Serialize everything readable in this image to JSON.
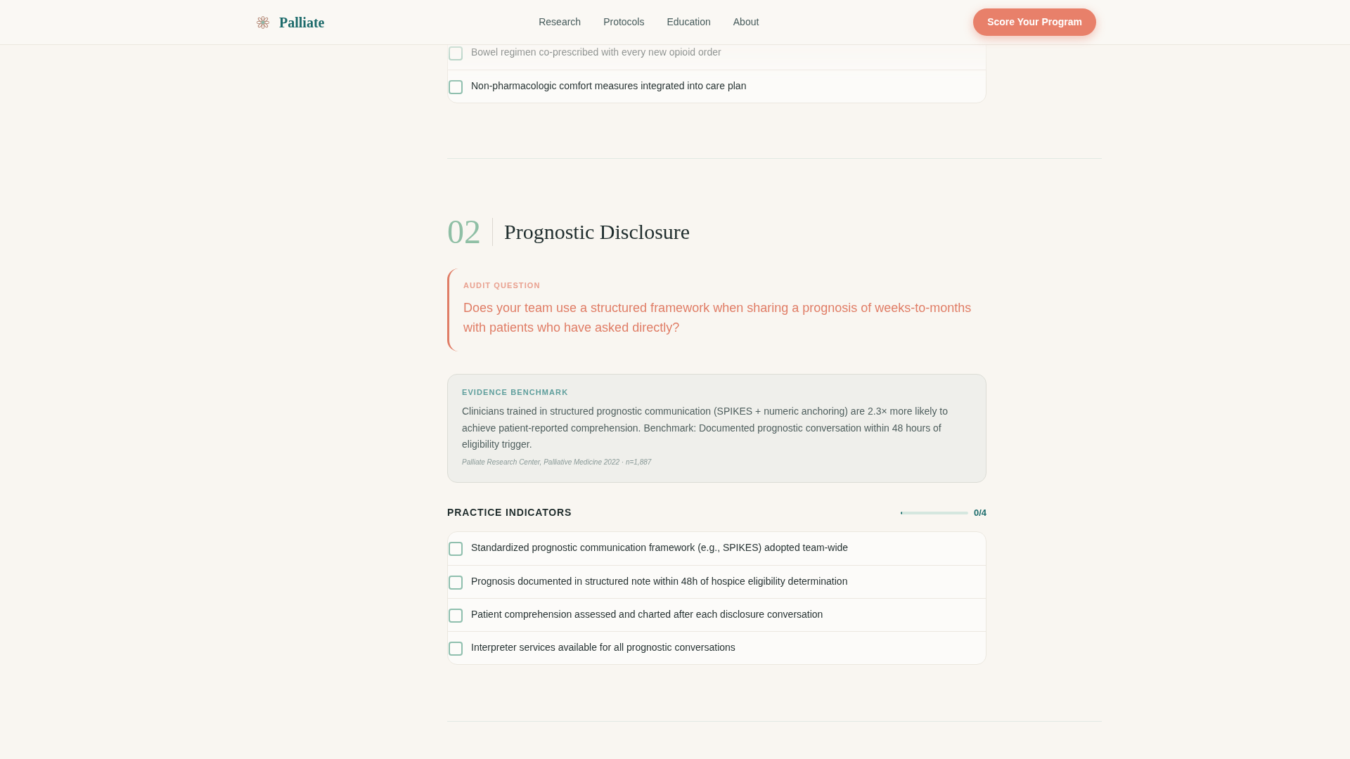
{
  "header": {
    "brand": "Palliate",
    "nav": [
      {
        "label": "Research"
      },
      {
        "label": "Protocols"
      },
      {
        "label": "Education"
      },
      {
        "label": "About"
      }
    ],
    "cta": "Score Your Program"
  },
  "sections": [
    {
      "indicators": [
        {
          "label": "Bowel regimen co-prescribed with every new opioid order",
          "checked": false
        },
        {
          "label": "Non-pharmacologic comfort measures integrated into care plan",
          "checked": false
        }
      ]
    },
    {
      "number": "02",
      "title": "Prognostic Disclosure",
      "audit_question": {
        "label": "AUDIT QUESTION",
        "text": "Does your team use a structured framework when sharing a prognosis of weeks-to-months with patients who have asked directly?"
      },
      "evidence": {
        "label": "EVIDENCE BENCHMARK",
        "text": "Clinicians trained in structured prognostic communication (SPIKES + numeric anchoring) are 2.3× more likely to achieve patient-reported comprehension. Benchmark: Documented prognostic conversation within 48 hours of eligibility trigger.",
        "citation": "Palliate Research Center, Palliative Medicine 2022 · n=1,887"
      },
      "indicators_heading": "PRACTICE INDICATORS",
      "progress": {
        "level": 0,
        "reading": "0/4"
      },
      "indicators": [
        {
          "label": "Standardized prognostic communication framework (e.g., SPIKES) adopted team-wide",
          "checked": false
        },
        {
          "label": "Prognosis documented in structured note within 48h of hospice eligibility determination",
          "checked": false
        },
        {
          "label": "Patient comprehension assessed and charted after each disclosure conversation",
          "checked": false
        },
        {
          "label": "Interpreter services available for all prognostic conversations",
          "checked": false
        }
      ]
    }
  ]
}
